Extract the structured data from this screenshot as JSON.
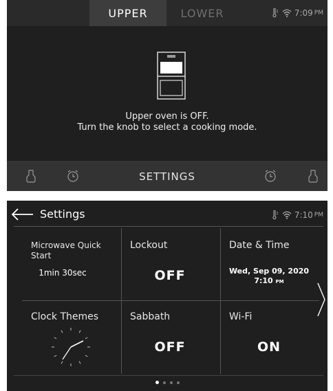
{
  "upper_screen": {
    "tabs": {
      "upper": "UPPER",
      "lower": "LOWER"
    },
    "status": {
      "time": "7:09",
      "ampm": "PM",
      "icons": [
        "probe-icon",
        "wifi-icon"
      ]
    },
    "oven_icon": "double-oven-icon",
    "message": {
      "line1": "Upper oven is OFF.",
      "line2": "Turn the knob to select a cooking mode."
    },
    "bottom_bar": {
      "settings_label": "SETTINGS",
      "icons": [
        "oven-light-icon",
        "timer-icon",
        "timer-icon",
        "oven-light-icon"
      ]
    }
  },
  "settings_screen": {
    "title": "Settings",
    "status": {
      "time": "7:10",
      "ampm": "PM",
      "icons": [
        "probe-icon",
        "wifi-icon"
      ]
    },
    "tiles": {
      "microwave": {
        "label": "Microwave Quick Start",
        "value": "1min 30sec"
      },
      "lockout": {
        "label": "Lockout",
        "value": "OFF"
      },
      "datetime": {
        "label": "Date & Time",
        "date": "Wed, Sep 09, 2020",
        "time": "7:10",
        "ampm": "PM"
      },
      "clock_themes": {
        "label": "Clock Themes"
      },
      "sabbath": {
        "label": "Sabbath",
        "value": "OFF"
      },
      "wifi": {
        "label": "Wi-Fi",
        "value": "ON"
      }
    },
    "pagination": {
      "current": 1,
      "total": 4
    }
  },
  "colors": {
    "screen_bg": "#1f1f1f",
    "tab_active_bg": "#3d3d3d",
    "bottom_bar_bg": "#333333",
    "text": "#ffffff",
    "muted_text": "#6f6f6f",
    "divider": "#555555"
  }
}
